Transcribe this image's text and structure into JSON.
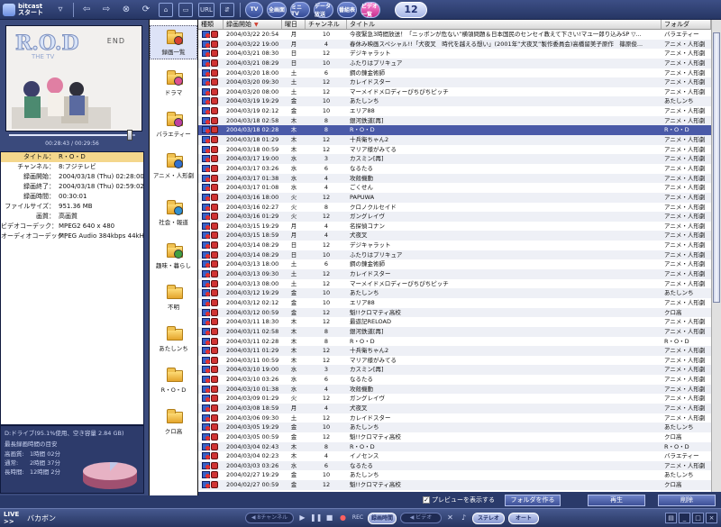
{
  "toolbar": {
    "logo_line1": "bitcast",
    "logo_line2": "スタート",
    "url_label": "URL",
    "round_buttons": [
      "TV",
      "全画面",
      "ミニTV",
      "データ放送",
      "番組表",
      "ビデオ一覧"
    ],
    "page": "12"
  },
  "video": {
    "title_art": "R.O.D",
    "subtitle_art": "THE TV",
    "end_label": "END",
    "timecode": "00:28:43 / 00:29:56",
    "seek_fraction": 0.96
  },
  "info": [
    {
      "k": "タイトル：",
      "v": "R・O・D"
    },
    {
      "k": "チャンネル：",
      "v": "8:フジテレビ"
    },
    {
      "k": "録画開始：",
      "v": "2004/03/18 (Thu) 02:28:00"
    },
    {
      "k": "録画終了：",
      "v": "2004/03/18 (Thu) 02:59:02"
    },
    {
      "k": "録画時間：",
      "v": "00:30:01"
    },
    {
      "k": "ファイルサイズ：",
      "v": "951.36 MB"
    },
    {
      "k": "画質：",
      "v": "高画質"
    },
    {
      "k": "ビデオコーデック：",
      "v": "MPEG2 640 x 480"
    },
    {
      "k": "オーディオコーデック：",
      "v": "MPEG Audio 384kbps 44kHz"
    }
  ],
  "disk": {
    "drive_text": "D:ドライブ(95.1%使用、空き容量 2.84 GB)",
    "remaining_label": "最長録画時間の目安",
    "modes": [
      {
        "k": "高画質:",
        "v": "1時間 02分"
      },
      {
        "k": "通常:",
        "v": "2時間 37分"
      },
      {
        "k": "長時間:",
        "v": "12時間 2分"
      }
    ],
    "used_fraction": 0.951
  },
  "categories": [
    {
      "label": "録画一覧",
      "icon": "recording-list-icon",
      "selected": true
    },
    {
      "label": "ドラマ",
      "icon": "drama-icon"
    },
    {
      "label": "バラエティー",
      "icon": "variety-icon"
    },
    {
      "label": "アニメ・人形劇",
      "icon": "anime-icon"
    },
    {
      "label": "社会・報道",
      "icon": "news-icon"
    },
    {
      "label": "趣味・暮らし",
      "icon": "hobby-icon"
    },
    {
      "label": "不明",
      "icon": "folder-icon"
    },
    {
      "label": "あたしンち",
      "icon": "folder-icon"
    },
    {
      "label": "R・O・D",
      "icon": "folder-icon"
    },
    {
      "label": "クロ高",
      "icon": "folder-icon"
    }
  ],
  "list": {
    "headers": [
      "種類",
      "録画開始",
      "曜日",
      "チャンネル",
      "タイトル",
      "フォルダ"
    ],
    "rows": [
      [
        "2004/03/22 20:54",
        "月",
        "10",
        "今夜緊急3時間放送！「ニッポンが危ない”横領問題＆日本国民のセンセイ教えて下さい!マユ一郎り込みSP ▽...",
        "バラエティー"
      ],
      [
        "2004/03/22 19:00",
        "月",
        "4",
        "春休み映画スペシャル!!「犬夜叉　時代を越える想い」(2001年”犬夜叉”製作委員会)高橋留美子原作　篠原俊...",
        "アニメ・人形劇"
      ],
      [
        "2004/03/21 08:30",
        "日",
        "12",
        "デジキャラット",
        "アニメ・人形劇"
      ],
      [
        "2004/03/21 08:29",
        "日",
        "10",
        "ふたりはプリキュア",
        "アニメ・人形劇"
      ],
      [
        "2004/03/20 18:00",
        "土",
        "6",
        "鋼の錬金術師",
        "アニメ・人形劇"
      ],
      [
        "2004/03/20 09:30",
        "土",
        "12",
        "カレイドスター",
        "アニメ・人形劇"
      ],
      [
        "2004/03/20 08:00",
        "土",
        "12",
        "マーメイドメロディーぴちぴちピッチ",
        "アニメ・人形劇"
      ],
      [
        "2004/03/19 19:29",
        "金",
        "10",
        "あたしンち",
        "あたしンち"
      ],
      [
        "2004/03/19 02:12",
        "金",
        "10",
        "エリア88",
        "アニメ・人形劇"
      ],
      [
        "2004/03/18 02:58",
        "木",
        "8",
        "銀河鉄道[再]",
        "アニメ・人形劇"
      ],
      [
        "2004/03/18 02:28",
        "木",
        "8",
        "R・O・D",
        "R・O・D"
      ],
      [
        "2004/03/18 01:29",
        "木",
        "12",
        "十兵衛ちゃん2",
        "アニメ・人形劇"
      ],
      [
        "2004/03/18 00:59",
        "木",
        "12",
        "マリア様がみてる",
        "アニメ・人形劇"
      ],
      [
        "2004/03/17 19:00",
        "水",
        "3",
        "カスミン[再]",
        "アニメ・人形劇"
      ],
      [
        "2004/03/17 03:26",
        "水",
        "6",
        "なるたる",
        "アニメ・人形劇"
      ],
      [
        "2004/03/17 01:38",
        "水",
        "4",
        "攻殻機動",
        "アニメ・人形劇"
      ],
      [
        "2004/03/17 01:08",
        "水",
        "4",
        "ごくせん",
        "アニメ・人形劇"
      ],
      [
        "2004/03/16 18:00",
        "火",
        "12",
        "PAPUWA",
        "アニメ・人形劇"
      ],
      [
        "2004/03/16 02:27",
        "火",
        "8",
        "クロノクルセイド",
        "アニメ・人形劇"
      ],
      [
        "2004/03/16 01:29",
        "火",
        "12",
        "ガングレイヴ",
        "アニメ・人形劇"
      ],
      [
        "2004/03/15 19:29",
        "月",
        "4",
        "名探偵コナン",
        "アニメ・人形劇"
      ],
      [
        "2004/03/15 18:59",
        "月",
        "4",
        "犬夜叉",
        "アニメ・人形劇"
      ],
      [
        "2004/03/14 08:29",
        "日",
        "12",
        "デジキャラット",
        "アニメ・人形劇"
      ],
      [
        "2004/03/14 08:29",
        "日",
        "10",
        "ふたりはプリキュア",
        "アニメ・人形劇"
      ],
      [
        "2004/03/13 18:00",
        "土",
        "6",
        "鋼の錬金術師",
        "アニメ・人形劇"
      ],
      [
        "2004/03/13 09:30",
        "土",
        "12",
        "カレイドスター",
        "アニメ・人形劇"
      ],
      [
        "2004/03/13 08:00",
        "土",
        "12",
        "マーメイドメロディーぴちぴちピッチ",
        "アニメ・人形劇"
      ],
      [
        "2004/03/12 19:29",
        "金",
        "10",
        "あたしンち",
        "あたしンち"
      ],
      [
        "2004/03/12 02:12",
        "金",
        "10",
        "エリア88",
        "アニメ・人形劇"
      ],
      [
        "2004/03/12 00:59",
        "金",
        "12",
        "魁!!クロマティ高校",
        "クロ高"
      ],
      [
        "2004/03/11 18:30",
        "木",
        "12",
        "最遊記RELOAD",
        "アニメ・人形劇"
      ],
      [
        "2004/03/11 02:58",
        "木",
        "8",
        "銀河鉄道[再]",
        "アニメ・人形劇"
      ],
      [
        "2004/03/11 02:28",
        "木",
        "8",
        "R・O・D",
        "R・O・D"
      ],
      [
        "2004/03/11 01:29",
        "木",
        "12",
        "十兵衛ちゃん2",
        "アニメ・人形劇"
      ],
      [
        "2004/03/11 00:59",
        "木",
        "12",
        "マリア様がみてる",
        "アニメ・人形劇"
      ],
      [
        "2004/03/10 19:00",
        "水",
        "3",
        "カスミン[再]",
        "アニメ・人形劇"
      ],
      [
        "2004/03/10 03:26",
        "水",
        "6",
        "なるたる",
        "アニメ・人形劇"
      ],
      [
        "2004/03/10 01:38",
        "水",
        "4",
        "攻殻機動",
        "アニメ・人形劇"
      ],
      [
        "2004/03/09 01:29",
        "火",
        "12",
        "ガングレイヴ",
        "アニメ・人形劇"
      ],
      [
        "2004/03/08 18:59",
        "月",
        "4",
        "犬夜叉",
        "アニメ・人形劇"
      ],
      [
        "2004/03/06 09:30",
        "土",
        "12",
        "カレイドスター",
        "アニメ・人形劇"
      ],
      [
        "2004/03/05 19:29",
        "金",
        "10",
        "あたしンち",
        "あたしンち"
      ],
      [
        "2004/03/05 00:59",
        "金",
        "12",
        "魁!!クロマティ高校",
        "クロ高"
      ],
      [
        "2004/03/04 02:43",
        "木",
        "8",
        "R・O・D",
        "R・O・D"
      ],
      [
        "2004/03/04 02:23",
        "木",
        "4",
        "イノセンス",
        "バラエティー"
      ],
      [
        "2004/03/03 03:26",
        "水",
        "6",
        "なるたる",
        "アニメ・人形劇"
      ],
      [
        "2004/02/27 19:29",
        "金",
        "10",
        "あたしンち",
        "あたしンち"
      ],
      [
        "2004/02/27 00:59",
        "金",
        "12",
        "魁!!クロマティ高校",
        "クロ高"
      ]
    ],
    "selected_index": 10
  },
  "bottom": {
    "preview_label": "プレビューを表示する",
    "make_folder": "フォルダを作る",
    "play": "再生",
    "delete": "削除"
  },
  "status": {
    "live": "LIVE >>",
    "now_playing": "バカボン",
    "pill1": "◀ 8チャンネル",
    "rec_label": "REC",
    "pill2": "録画時間",
    "pill3": "◀ ビデオ",
    "stereo": "ステレオ",
    "auto": "オート"
  }
}
